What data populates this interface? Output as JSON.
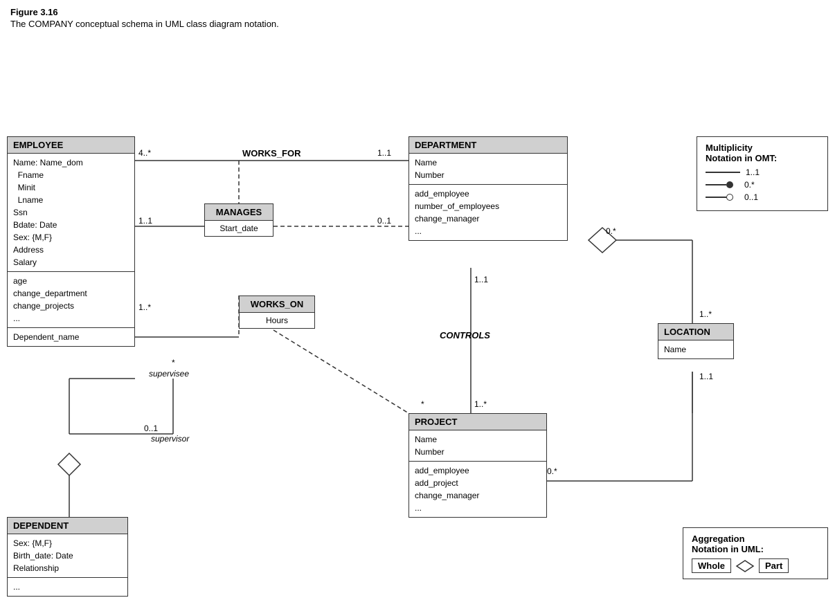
{
  "figure": {
    "title": "Figure 3.16",
    "caption": "The COMPANY conceptual schema in UML class diagram notation."
  },
  "classes": {
    "employee": {
      "header": "EMPLOYEE",
      "section1": [
        "Name: Name_dom",
        "  Fname",
        "  Minit",
        "  Lname",
        "Ssn",
        "Bdate: Date",
        "Sex: {M,F}",
        "Address",
        "Salary"
      ],
      "section2": [
        "age",
        "change_department",
        "change_projects",
        "..."
      ],
      "section3": [
        "Dependent_name"
      ]
    },
    "department": {
      "header": "DEPARTMENT",
      "section1": [
        "Name",
        "Number"
      ],
      "section2": [
        "add_employee",
        "number_of_employees",
        "change_manager",
        "..."
      ]
    },
    "project": {
      "header": "PROJECT",
      "section1": [
        "Name",
        "Number"
      ],
      "section2": [
        "add_employee",
        "add_project",
        "change_manager",
        "..."
      ]
    },
    "dependent": {
      "header": "DEPENDENT",
      "section1": [
        "Sex: {M,F}",
        "Birth_date: Date",
        "Relationship"
      ],
      "section2": [
        "..."
      ]
    },
    "location": {
      "header": "LOCATION",
      "section1": [
        "Name"
      ]
    }
  },
  "assoc": {
    "manages": {
      "header": "MANAGES",
      "body": "Start_date"
    },
    "works_on": {
      "header": "WORKS_ON",
      "body": "Hours"
    }
  },
  "multiplicities": {
    "works_for_left": "4..*",
    "works_for_label": "WORKS_FOR",
    "works_for_right": "1..1",
    "manages_top": "1..1",
    "manages_right": "0..1",
    "supervise_top": "1..*",
    "supervise_star": "*",
    "supervisee_label": "supervisee",
    "supervisor_label": "supervisor",
    "supervise_bottom": "0..1",
    "controls_label": "CONTROLS",
    "dept_project_top": "1..1",
    "dept_project_bottom": "1..*",
    "project_star": "*",
    "location_top": "0.*",
    "location_right_top": "1..*",
    "location_right_bottom": "1..1",
    "proj_agg": "0.*"
  },
  "notation": {
    "title_line1": "Multiplicity",
    "title_line2": "Notation in OMT:",
    "rows": [
      {
        "label": "1..1"
      },
      {
        "label": "0.*"
      },
      {
        "label": "0..1"
      }
    ]
  },
  "aggregation": {
    "title_line1": "Aggregation",
    "title_line2": "Notation in UML:",
    "whole_label": "Whole",
    "part_label": "Part"
  }
}
